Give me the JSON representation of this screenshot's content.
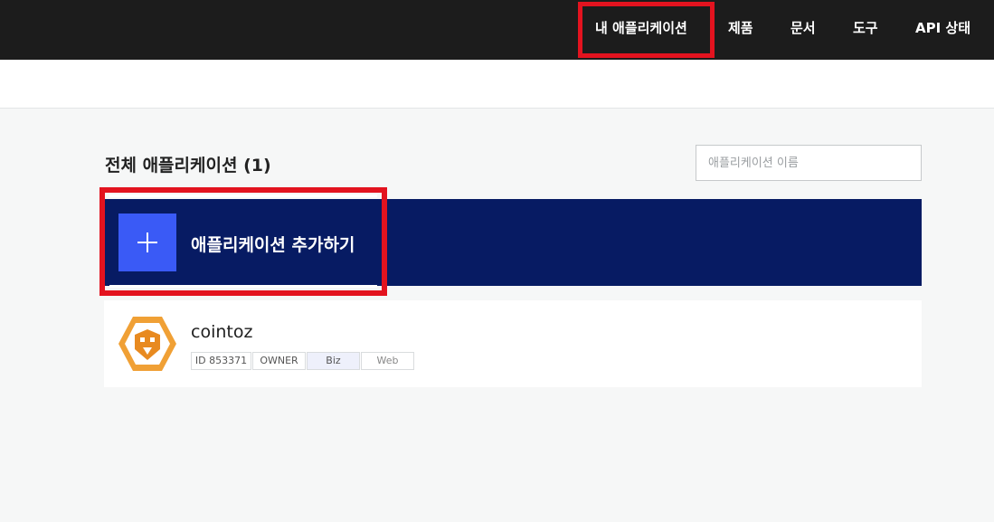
{
  "nav": {
    "items": [
      {
        "label": "내 애플리케이션",
        "active": true
      },
      {
        "label": "제품"
      },
      {
        "label": "문서"
      },
      {
        "label": "도구"
      },
      {
        "label": "API 상태"
      }
    ]
  },
  "main": {
    "title": "전체 애플리케이션 (1)",
    "search_placeholder": "애플리케이션 이름",
    "add_label": "애플리케이션 추가하기"
  },
  "apps": [
    {
      "name": "cointoz",
      "tags": [
        "ID 853371",
        "OWNER",
        "Biz",
        "Web"
      ],
      "logo_colors": {
        "outer": "#f0a035",
        "inner": "#ffffff",
        "face": "#e88a20"
      }
    }
  ],
  "colors": {
    "topbar": "#1c1c1c",
    "highlight": "#e3131f",
    "banner": "#071b63",
    "plus_box": "#3a5af6"
  }
}
